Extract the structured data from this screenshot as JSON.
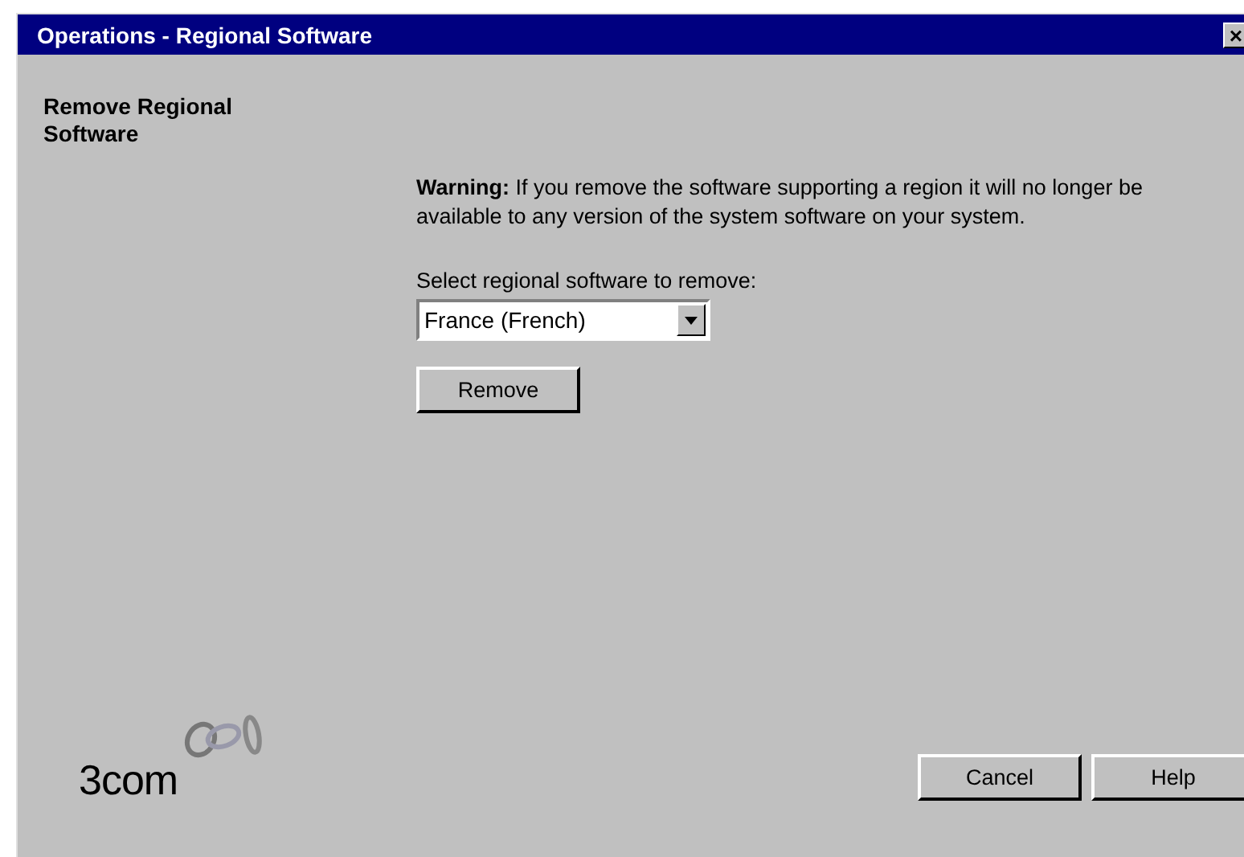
{
  "window": {
    "title": "Operations - Regional Software",
    "close": "×"
  },
  "heading": "Remove Regional Software",
  "warning": "**Warning:** If you remove the software supporting a region it will no longer be available to any version of the system software on your system.",
  "select": {
    "label": "Select regional software to remove:",
    "value": "France (French)"
  },
  "remove_button": "Remove",
  "logo": {
    "text": "3com"
  },
  "buttons": [
    "Cancel",
    "Help"
  ]
}
